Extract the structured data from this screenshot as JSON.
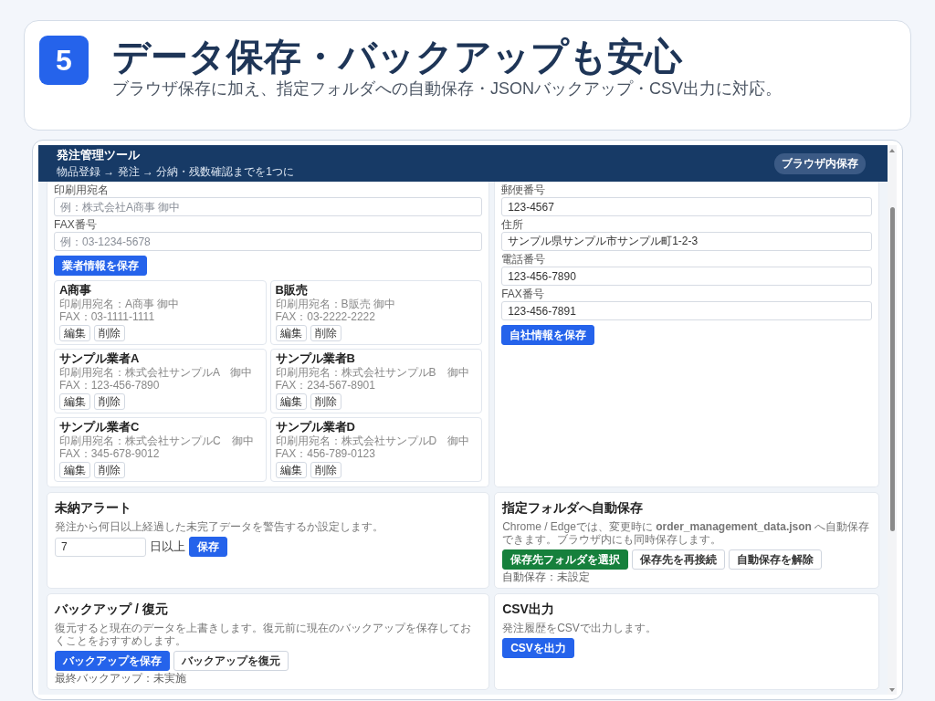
{
  "slide": {
    "badge": "5",
    "title": "データ保存・バックアップも安心",
    "subtitle": "ブラウザ保存に加え、指定フォルダへの自動保存・JSONバックアップ・CSV出力に対応。"
  },
  "app": {
    "title": "発注管理ツール",
    "subtitle": "物品登録 → 発注 → 分納・残数確認までを1つに",
    "storage_badge": "ブラウザ内保存"
  },
  "vendor_form": {
    "fields": [
      {
        "label": "印刷用宛名",
        "placeholder": "例：株式会社A商事 御中"
      },
      {
        "label": "FAX番号",
        "placeholder": "例：03-1234-5678"
      }
    ],
    "save_button": "業者情報を保存",
    "vendors": [
      {
        "name": "A商事",
        "print_name": "印刷用宛名：A商事 御中",
        "fax": "FAX：03-1111-1111",
        "edit": "編集",
        "delete": "削除"
      },
      {
        "name": "B販売",
        "print_name": "印刷用宛名：B販売 御中",
        "fax": "FAX：03-2222-2222",
        "edit": "編集",
        "delete": "削除"
      },
      {
        "name": "サンプル業者A",
        "print_name": "印刷用宛名：株式会社サンプルA　御中",
        "fax": "FAX：123-456-7890",
        "edit": "編集",
        "delete": "削除"
      },
      {
        "name": "サンプル業者B",
        "print_name": "印刷用宛名：株式会社サンプルB　御中",
        "fax": "FAX：234-567-8901",
        "edit": "編集",
        "delete": "削除"
      },
      {
        "name": "サンプル業者C",
        "print_name": "印刷用宛名：株式会社サンプルC　御中",
        "fax": "FAX：345-678-9012",
        "edit": "編集",
        "delete": "削除"
      },
      {
        "name": "サンプル業者D",
        "print_name": "印刷用宛名：株式会社サンプルD　御中",
        "fax": "FAX：456-789-0123",
        "edit": "編集",
        "delete": "削除"
      }
    ]
  },
  "company_form": {
    "fields": [
      {
        "label": "郵便番号",
        "value": "123-4567"
      },
      {
        "label": "住所",
        "value": "サンプル県サンプル市サンプル町1-2-3"
      },
      {
        "label": "電話番号",
        "value": "123-456-7890"
      },
      {
        "label": "FAX番号",
        "value": "123-456-7891"
      }
    ],
    "save_button": "自社情報を保存"
  },
  "alert": {
    "title": "未納アラート",
    "description": "発注から何日以上経過した未完了データを警告するか設定します。",
    "days_value": "7",
    "unit": "日以上",
    "save_button": "保存"
  },
  "autosave": {
    "title": "指定フォルダへ自動保存",
    "description": "Chrome / Edgeでは、変更時に **order_management_data.json** へ自動保存できます。ブラウザ内にも同時保存します。",
    "buttons": [
      {
        "label": "保存先フォルダを選択",
        "kind": "success"
      },
      {
        "label": "保存先を再接続",
        "kind": "outline"
      },
      {
        "label": "自動保存を解除",
        "kind": "outline"
      }
    ],
    "status": "自動保存：未設定"
  },
  "backup": {
    "title": "バックアップ / 復元",
    "description": "復元すると現在のデータを上書きします。復元前に現在のバックアップを保存しておくことをおすすめします。",
    "buttons": [
      {
        "label": "バックアップを保存",
        "kind": "primary"
      },
      {
        "label": "バックアップを復元",
        "kind": "outline"
      }
    ],
    "status": "最終バックアップ：未実施"
  },
  "csv": {
    "title": "CSV出力",
    "description": "発注履歴をCSVで出力します。",
    "buttons": [
      {
        "label": "CSVを出力",
        "kind": "primary"
      }
    ]
  }
}
